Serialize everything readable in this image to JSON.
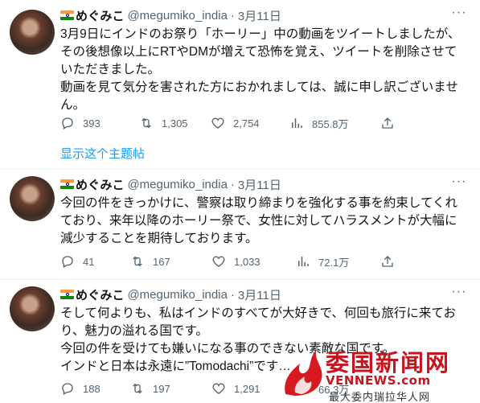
{
  "tweets": [
    {
      "author_name": "めぐみこ",
      "handle": "@megumiko_india",
      "dot": "·",
      "date": "3月11日",
      "more": "···",
      "text": "3月9日にインドのお祭り「ホーリー」中の動画をツイートしましたが、その後想像以上にRTやDMが増えて恐怖を覚え、ツイートを削除させていただきました。\n動画を見て気分を害された方におかれましては、誠に申し訳ございません。",
      "replies": "393",
      "retweets": "1,305",
      "likes": "2,754",
      "views": "855.8万",
      "thread_link": "显示这个主题帖"
    },
    {
      "author_name": "めぐみこ",
      "handle": "@megumiko_india",
      "dot": "·",
      "date": "3月11日",
      "more": "···",
      "text": "今回の件をきっかけに、警察は取り締まりを強化する事を約束してくれており、来年以降のホーリー祭で、女性に対してハラスメントが大幅に減少することを期待しております。",
      "replies": "41",
      "retweets": "167",
      "likes": "1,033",
      "views": "72.1万"
    },
    {
      "author_name": "めぐみこ",
      "handle": "@megumiko_india",
      "dot": "·",
      "date": "3月11日",
      "more": "···",
      "text": "そして何よりも、私はインドのすべてが大好きで、何回も旅行に来ており、魅力の溢れる国です。\n今回の件を受けても嫌いになる事のできない素敵な国です。\nインドと日本は永遠に”Tomodachi”です…",
      "replies": "188",
      "retweets": "197",
      "likes": "1,291",
      "views": "66.3万"
    }
  ],
  "watermark": {
    "title": "委国新闻网",
    "url": "VENNEWS.com",
    "subtitle": "最大委内瑞拉华人网"
  },
  "colors": {
    "link": "#1d9bf0",
    "muted": "#536471",
    "watermark": "#c4161c"
  }
}
